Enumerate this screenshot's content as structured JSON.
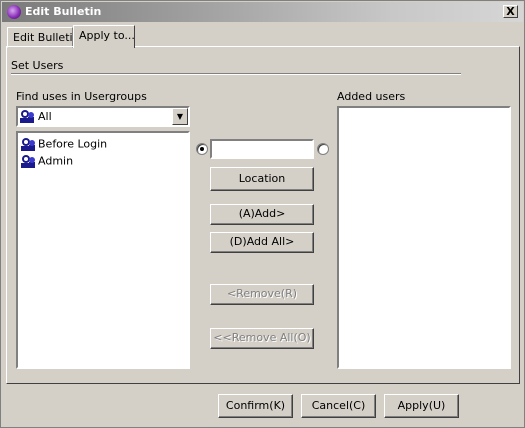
{
  "window": {
    "title": "Edit Bulletin",
    "close_label": "X"
  },
  "tabs": [
    {
      "label": "Edit Bulletin",
      "active": false
    },
    {
      "label": "Apply to...",
      "active": true
    }
  ],
  "section": {
    "title": "Set Users"
  },
  "find": {
    "label": "Find uses in Usergroups",
    "combo_value": "All",
    "list": [
      {
        "label": "Before Login"
      },
      {
        "label": "Admin"
      }
    ]
  },
  "middle": {
    "text_value": "",
    "radio_left_checked": true,
    "radio_right_checked": false,
    "location_label": "Location",
    "add_label": "(A)Add>",
    "add_all_label": "(D)Add All>",
    "remove_label": "<Remove(R)",
    "remove_all_label": "<<Remove All(O)"
  },
  "added": {
    "label": "Added users",
    "list": []
  },
  "footer": {
    "confirm_label": "Confirm(K)",
    "cancel_label": "Cancel(C)",
    "apply_label": "Apply(U)"
  },
  "colors": {
    "face": "#d4d0c8",
    "shadow": "#808080",
    "highlight": "#ffffff",
    "dark": "#404040"
  }
}
